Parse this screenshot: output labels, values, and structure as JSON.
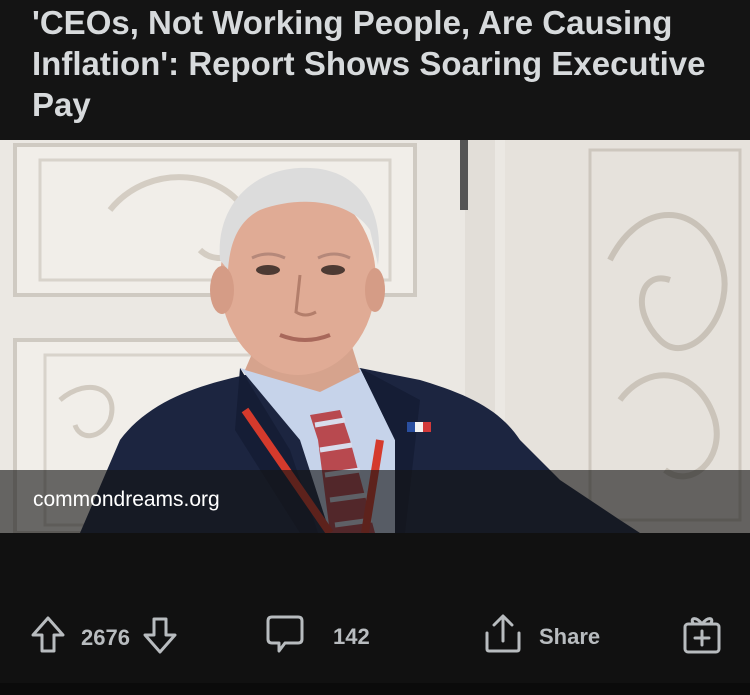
{
  "post": {
    "title": "'CEOs, Not Working People, Are Causing Inflation': Report Shows Soaring Executive Pay",
    "link_domain": "commondreams.org"
  },
  "actions": {
    "vote_count": "2676",
    "comment_count": "142",
    "share_label": "Share"
  },
  "icons": [
    "upvote-arrow-icon",
    "downvote-arrow-icon",
    "comment-bubble-icon",
    "share-icon",
    "award-gift-icon"
  ]
}
